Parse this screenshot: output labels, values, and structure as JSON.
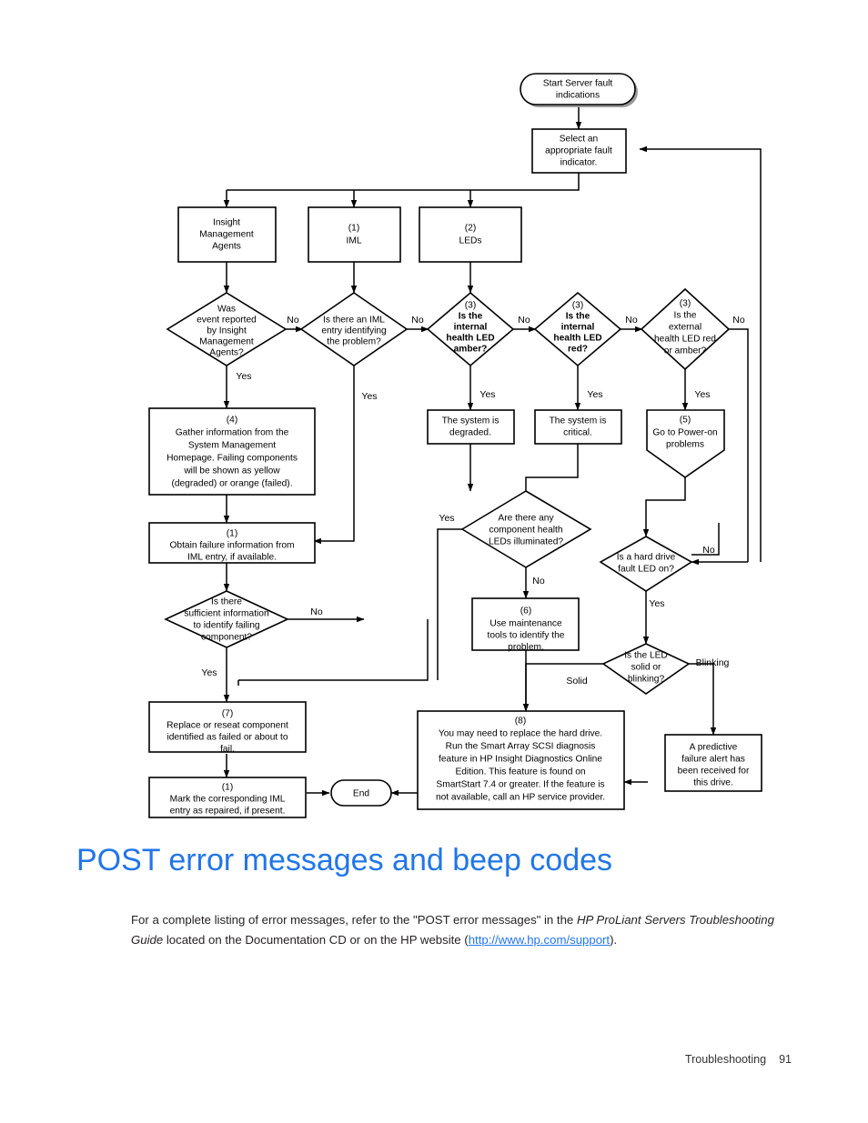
{
  "page": {
    "footer_section": "Troubleshooting",
    "footer_page_number": "91"
  },
  "heading": {
    "text": "POST error messages and beep codes",
    "color": "#2176e8"
  },
  "paragraph": {
    "part1": "For a complete listing of error messages, refer to the \"POST error messages\" in the ",
    "italic1": "HP ProLiant Servers Troubleshooting Guide",
    "part2": " located on the Documentation CD or on the HP website (",
    "link": "http://www.hp.com/support",
    "part3": ")."
  },
  "flowchart": {
    "title": "Server fault indications troubleshooting flowchart",
    "nodes": {
      "start": "Start Server fault indications",
      "select": "Select an appropriate fault indicator.",
      "ima": "Insight Management Agents",
      "iml_ref": "(1)",
      "iml": "IML",
      "leds_ref": "(2)",
      "leds": "LEDs",
      "d_was_event": "Was event reported by Insight Management Agents?",
      "d_iml_entry": "Is there an IML entry identifying the problem?",
      "d_internal_amber_ref": "(3)",
      "d_internal_amber": "Is the internal health LED amber?",
      "d_internal_red_ref": "(3)",
      "d_internal_red": "Is the internal health LED red?",
      "d_external_ref": "(3)",
      "d_external": "Is the external health LED red or amber?",
      "gather_ref": "(4)",
      "gather": "Gather information from the System Management Homepage. Failing components will be shown as yellow (degraded) or orange (failed).",
      "degraded": "The system is degraded.",
      "critical": "The system is critical.",
      "poweron_ref": "(5)",
      "poweron": "Go to Power-on problems",
      "obtain_ref": "(1)",
      "obtain": "Obtain failure information from IML entry, if available.",
      "d_component_leds": "Are there any component health LEDs illuminated?",
      "d_hard_drive": "Is a hard drive fault LED on?",
      "d_sufficient": "Is there sufficient information to identify failing component?",
      "maintenance_ref": "(6)",
      "maintenance": "Use maintenance tools to identify the problem.",
      "d_solid_blinking": "Is the LED solid or blinking?",
      "replace_ref": "(7)",
      "replace": "Replace or reseat component identified as failed or about to fail.",
      "harddrive_ref": "(8)",
      "harddrive": "You may need to replace the hard drive. Run the Smart Array SCSI diagnosis feature in HP Insight Diagnostics Online Edition. This feature is found on SmartStart 7.4 or greater. If the feature is not available, call an HP service provider.",
      "predictive": "A predictive failure alert has been received for this drive.",
      "mark_ref": "(1)",
      "mark": "Mark the corresponding IML entry as repaired, if present.",
      "end": "End"
    },
    "edge_labels": {
      "no1": "No",
      "no2": "No",
      "no3": "No",
      "no4": "No",
      "no5": "No",
      "no6": "No",
      "no7": "No",
      "yes1": "Yes",
      "yes2": "Yes",
      "yes3": "Yes",
      "yes4": "Yes",
      "yes5": "Yes",
      "yes6": "Yes",
      "yes7": "Yes",
      "yes8": "Yes",
      "solid": "Solid",
      "blinking": "Blinking"
    }
  }
}
